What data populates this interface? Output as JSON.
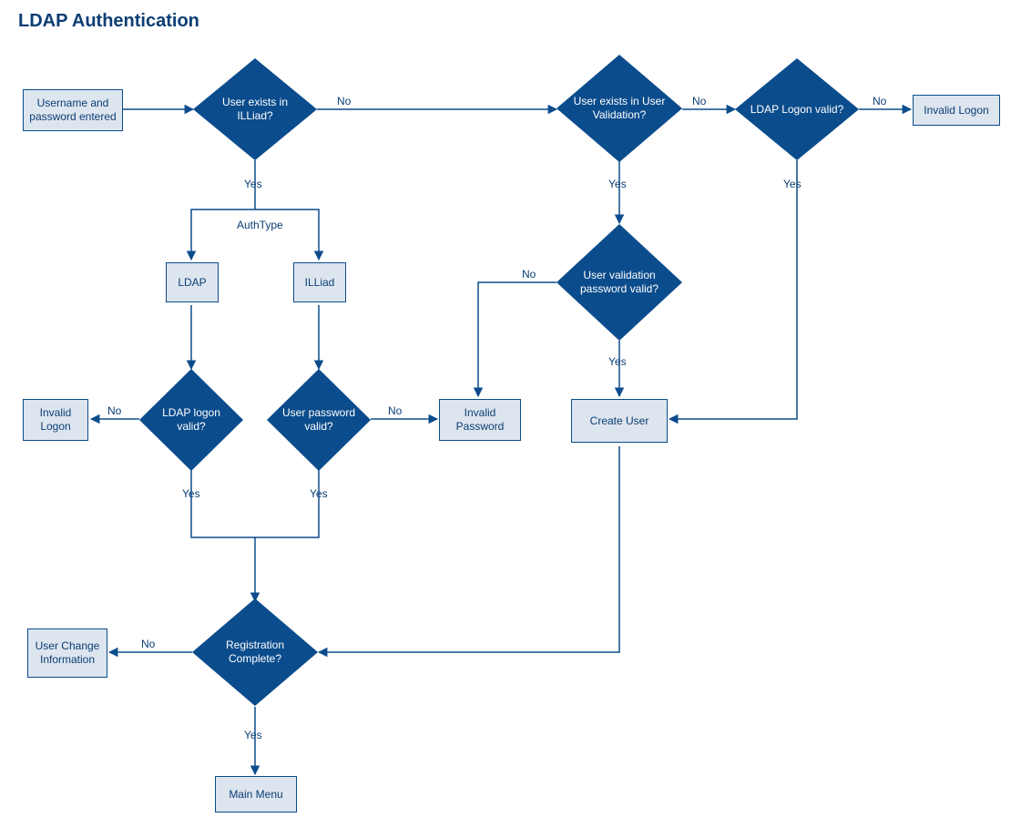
{
  "title": "LDAP Authentication",
  "boxes": {
    "start": "Username and password entered",
    "ldap": "LDAP",
    "illiad": "ILLiad",
    "invalid_logon_left": "Invalid Logon",
    "invalid_password": "Invalid Password",
    "invalid_logon_right": "Invalid Logon",
    "create_user": "Create User",
    "user_change": "User Change Information",
    "main_menu": "Main Menu"
  },
  "diamonds": {
    "d_user_illiad": "User exists in ILLiad?",
    "d_user_validation": "User exists in User Validation?",
    "d_ldap_logon_valid_top": "LDAP Logon valid?",
    "d_user_val_pw": "User validation password valid?",
    "d_ldap_logon_valid_left": "LDAP logon valid?",
    "d_user_pw_valid": "User password valid?",
    "d_registration": "Registration Complete?"
  },
  "labels": {
    "yes": "Yes",
    "no": "No",
    "authtype": "AuthType"
  }
}
